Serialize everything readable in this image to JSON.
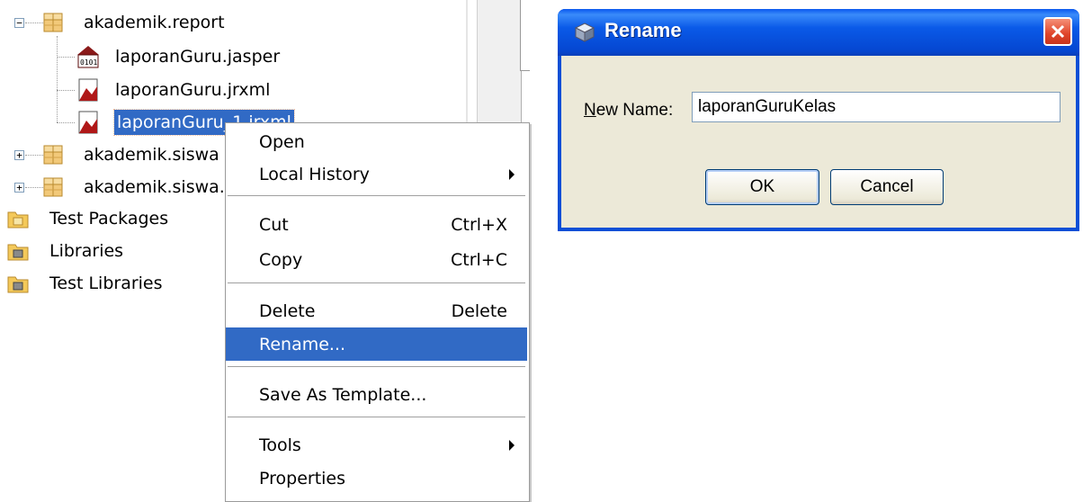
{
  "tree": {
    "nodes": [
      {
        "label": "akademik.report",
        "kind": "package",
        "expander": "−"
      },
      {
        "label": "laporanGuru.jasper",
        "kind": "jasper"
      },
      {
        "label": "laporanGuru.jrxml",
        "kind": "jrxml"
      },
      {
        "label": "laporanGuru_1.jrxml",
        "kind": "jrxml",
        "selected": true
      },
      {
        "label": "akademik.siswa",
        "kind": "package",
        "expander": "+"
      },
      {
        "label": "akademik.siswa.",
        "kind": "package",
        "expander": "+"
      },
      {
        "label": "Test Packages",
        "kind": "folder"
      },
      {
        "label": "Libraries",
        "kind": "folder"
      },
      {
        "label": "Test Libraries",
        "kind": "folder"
      }
    ]
  },
  "context_menu": {
    "items": [
      {
        "label": "Open",
        "shortcut": ""
      },
      {
        "label": "Local History",
        "shortcut": "",
        "submenu": true
      },
      {
        "label": "Cut",
        "shortcut": "Ctrl+X"
      },
      {
        "label": "Copy",
        "shortcut": "Ctrl+C"
      },
      {
        "label": "Delete",
        "shortcut": "Delete"
      },
      {
        "label": "Rename...",
        "shortcut": "",
        "highlighted": true
      },
      {
        "label": "Save As Template...",
        "shortcut": ""
      },
      {
        "label": "Tools",
        "shortcut": "",
        "submenu": true
      },
      {
        "label": "Properties",
        "shortcut": ""
      }
    ]
  },
  "dialog": {
    "title": "Rename",
    "field_label_mnemonic": "N",
    "field_label_rest": "ew Name:",
    "name_value": "laporanGuruKelas",
    "ok_label": "OK",
    "cancel_label": "Cancel"
  },
  "colors": {
    "selection": "#316ac5",
    "title_bar": "#0a58ee",
    "dialog_body": "#ece9d8",
    "close_button": "#e0452a"
  },
  "icons": {
    "package": "package-icon",
    "jasper": "jasper-report-icon",
    "jrxml": "jrxml-report-icon",
    "folder": "folder-icon",
    "dialog": "dialog-cube-icon",
    "close": "close-icon",
    "submenu": "submenu-arrow-icon"
  }
}
